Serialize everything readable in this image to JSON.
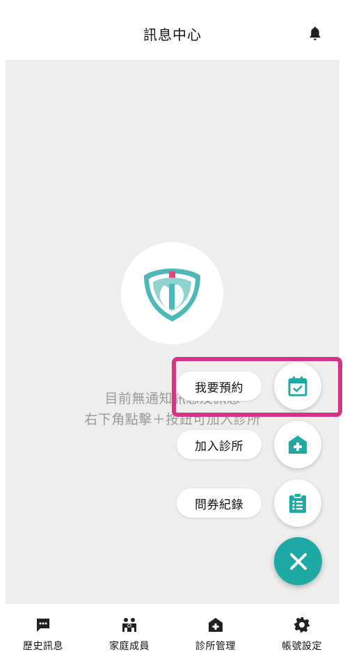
{
  "header": {
    "title": "訊息中心",
    "bell_icon": "bell-icon"
  },
  "empty_state": {
    "line1": "目前無通知訊息及訊息",
    "line2": "右下角點擊＋按鈕可加入診所"
  },
  "fab_menu": {
    "items": [
      {
        "label": "我要預約",
        "icon": "calendar-check-icon"
      },
      {
        "label": "加入診所",
        "icon": "clinic-plus-icon"
      },
      {
        "label": "問券紀錄",
        "icon": "clipboard-list-icon"
      }
    ],
    "close_icon": "close-icon"
  },
  "bottom_nav": {
    "items": [
      {
        "label": "歷史訊息",
        "icon": "chat-icon"
      },
      {
        "label": "家庭成員",
        "icon": "family-icon"
      },
      {
        "label": "診所管理",
        "icon": "clinic-icon"
      },
      {
        "label": "帳號設定",
        "icon": "gear-icon"
      }
    ]
  },
  "colors": {
    "accent": "#1fa9a5",
    "highlight": "#d63384",
    "background": "#eeeeed"
  }
}
